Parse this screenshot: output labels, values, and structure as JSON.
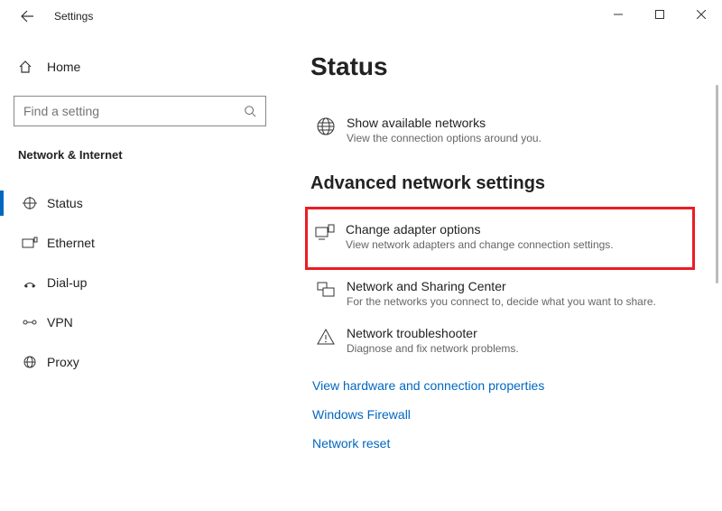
{
  "window": {
    "title": "Settings"
  },
  "sidebar": {
    "home_label": "Home",
    "search_placeholder": "Find a setting",
    "category": "Network & Internet",
    "items": [
      {
        "id": "status",
        "label": "Status",
        "icon": "status-icon"
      },
      {
        "id": "ethernet",
        "label": "Ethernet",
        "icon": "ethernet-icon"
      },
      {
        "id": "dialup",
        "label": "Dial-up",
        "icon": "dialup-icon"
      },
      {
        "id": "vpn",
        "label": "VPN",
        "icon": "vpn-icon"
      },
      {
        "id": "proxy",
        "label": "Proxy",
        "icon": "proxy-icon"
      }
    ]
  },
  "main": {
    "heading": "Status",
    "show_networks": {
      "title": "Show available networks",
      "desc": "View the connection options around you."
    },
    "section_heading": "Advanced network settings",
    "adapter": {
      "title": "Change adapter options",
      "desc": "View network adapters and change connection settings."
    },
    "sharing": {
      "title": "Network and Sharing Center",
      "desc": "For the networks you connect to, decide what you want to share."
    },
    "troubleshoot": {
      "title": "Network troubleshooter",
      "desc": "Diagnose and fix network problems."
    },
    "links": {
      "hw": "View hardware and connection properties",
      "firewall": "Windows Firewall",
      "reset": "Network reset"
    }
  }
}
